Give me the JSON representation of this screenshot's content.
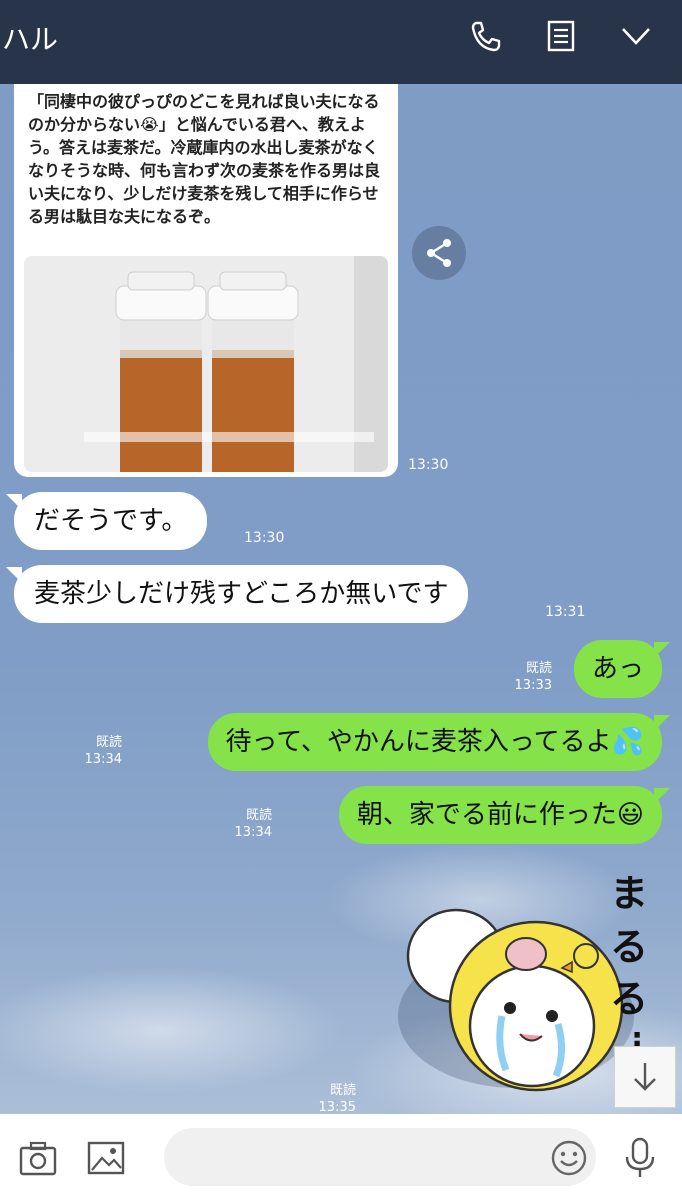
{
  "header": {
    "title": "ハル",
    "icons": [
      "phone-icon",
      "notes-icon",
      "chevron-down-icon"
    ]
  },
  "colors": {
    "header_bg": "#283449",
    "chat_bg": "#7e9cc4",
    "outgoing_bubble": "#85e249",
    "incoming_bubble": "#ffffff"
  },
  "shared_post": {
    "caption": "「同棲中の彼ぴっぴのどこを見れば良い夫になるのか分からない😭」と悩んでいる君へ、教えよう。答えは麦茶だ。冷蔵庫内の水出し麦茶がなくなりそうな時、何も言わず次の麦茶を作る男は良い夫になり、少しだけ麦茶を残して相手に作らせる男は駄目な夫になるぞ。",
    "time": "13:30"
  },
  "messages": [
    {
      "dir": "in",
      "text": "だそうです。",
      "time": "13:30"
    },
    {
      "dir": "in",
      "text": "麦茶少しだけ残すどころか無いです",
      "time": "13:31"
    },
    {
      "dir": "out",
      "text": "あっ",
      "read": "既読",
      "time": "13:33"
    },
    {
      "dir": "out",
      "text": "待って、やかんに麦茶入ってるよ💦",
      "read": "既読",
      "time": "13:34"
    },
    {
      "dir": "out",
      "text": "朝、家でる前に作った😃",
      "read": "既読",
      "time": "13:34"
    }
  ],
  "sticker": {
    "text": "まるる…",
    "read": "既読",
    "time": "13:35"
  },
  "footer": {
    "icons": [
      "camera-icon",
      "image-icon",
      "emoji-icon",
      "microphone-icon"
    ],
    "input_value": ""
  }
}
